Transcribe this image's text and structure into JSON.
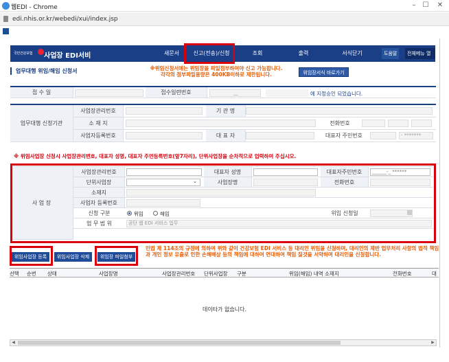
{
  "window": {
    "title": "웹EDI - Chrome",
    "url": "edi.nhis.or.kr/webedi/xui/index.jsp"
  },
  "nav": {
    "brand_small": "국민건강보험",
    "brand": "사업장 EDI서비스",
    "items": [
      "새문서",
      "신고(전송)/신청",
      "조회",
      "출력",
      "서식닫기"
    ],
    "help": "도움말",
    "menu_open": "전체메뉴 열기"
  },
  "page": {
    "title": "업무대행 위임/해임 신청서",
    "notice_line1": "※위임신청서에는 위임장을 파일첨부하여야 신고 가능합니다.",
    "notice_line2": "각각의 첨부파일용량은 400KB이하로 제한됩니다.",
    "form_button": "위임장서식 바로가기"
  },
  "receipt": {
    "date_label": "접 수 일",
    "serial_label": "접수일련번호",
    "serial_value": "__",
    "approved_text": "에 지정승인 되었습니다."
  },
  "agency": {
    "section_label": "업무대행 신청기관",
    "biz_mgmt_label": "사업장관리번호",
    "org_name_label": "기 관 명",
    "address_label": "소 재 지",
    "phone_label": "전화번호",
    "biz_reg_label": "사업자등록번호",
    "rep_label": "대 표 자",
    "rep_id_label": "대표자 주민번호",
    "rep_id_value": "- *******"
  },
  "warning": "※ 위임사업장 신청시 사업장관리번호, 대표자 성명, 대표자 주민등록번호(앞7자리), 단위사업장을 순차적으로 입력하여 주십시오.",
  "workplace": {
    "section_label": "사 업 장",
    "biz_mgmt_label": "사업장관리번호",
    "rep_name_label": "대표자 성명",
    "rep_id_label": "대표자주민번호",
    "rep_id_value": "______-_ ******",
    "unit_label": "단위사업장",
    "name_label": "사업장명",
    "phone_label": "전화번호",
    "address_label": "소재지",
    "biz_reg_label": "사업자 등록번호",
    "type_label": "신청 구분",
    "type_options": [
      "위임",
      "해임"
    ],
    "request_date_label": "위임 신청일",
    "scope_label": "업 무 범 위",
    "scope_value": "공단 웹 EDI 서비스 업무"
  },
  "actions": {
    "register": "위임사업장 등록",
    "delete": "위임사업장 삭제",
    "attach": "위임장 파일첨부"
  },
  "legal_text": "민법 제 114조의 규정에 의하여 위와 같이 건강보험 EDI 서비스 등 대리인 위임을 신청하며, 대리인의 제반 업무처리 사항의 법적 책임과 개인 정보 유출로 인한 손해배상 등의 책임에 대하여 연대하여 책임 질것을 서약하며 대리인을 신청합니다.",
  "grid": {
    "headers": [
      "선택",
      "순번",
      "상태",
      "사업장명",
      "사업장관리번호",
      "단위사업장",
      "구분",
      "위임(해임) 내역 소재지",
      "전화번호",
      "대"
    ],
    "empty": "데이타가 없습니다."
  }
}
